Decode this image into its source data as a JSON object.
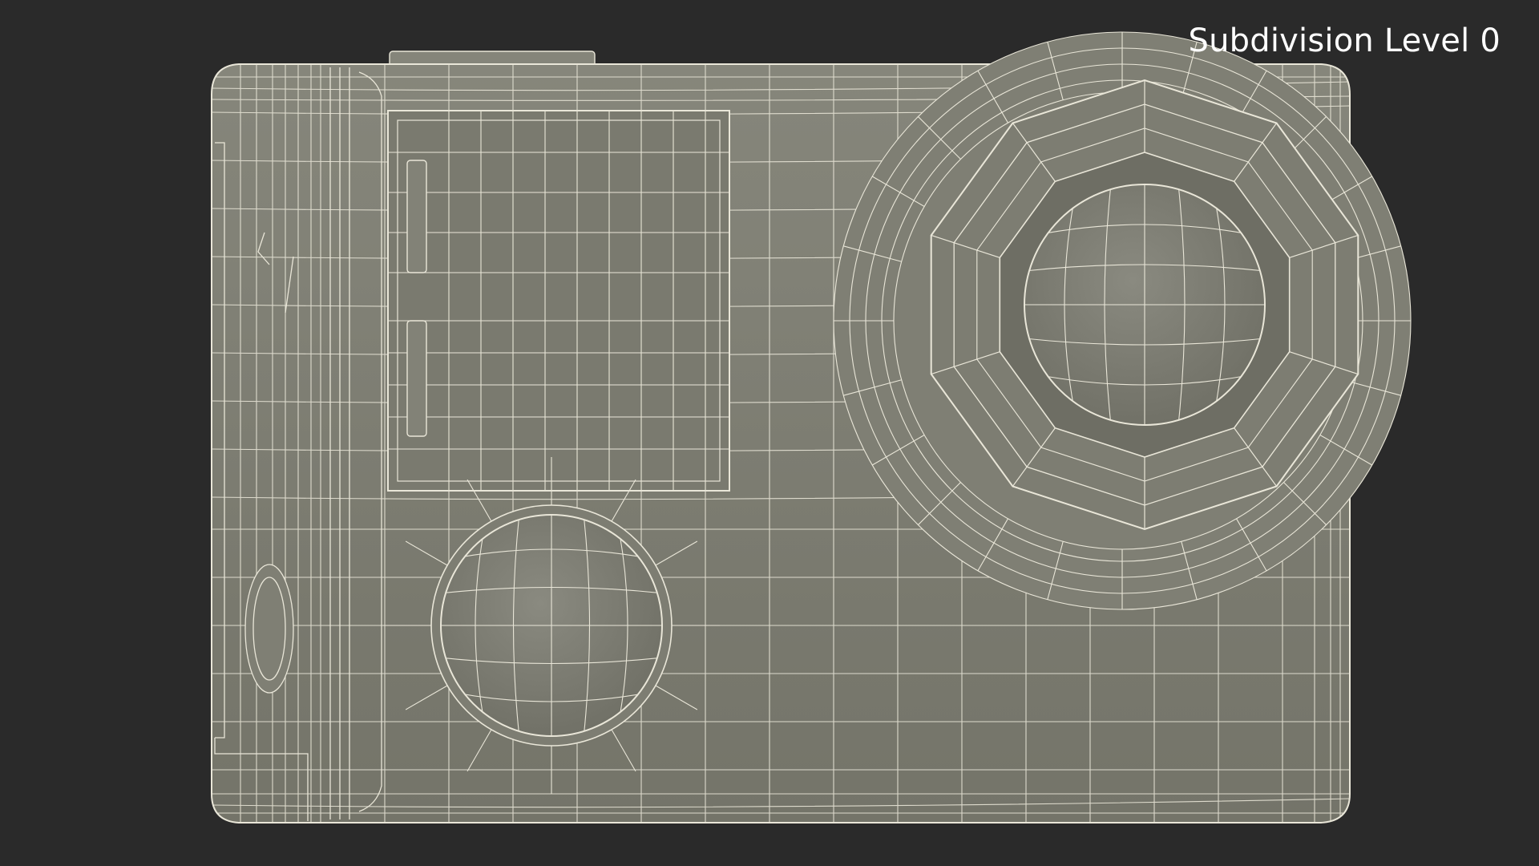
{
  "viewport": {
    "label": "Subdivision Level 0",
    "background_color": "#2a2a2a",
    "model_surface_color": "#7b7b70",
    "wire_color": "#e9e6d8"
  },
  "model": {
    "subject": "action camera",
    "render_style": "wireframe on shaded"
  }
}
